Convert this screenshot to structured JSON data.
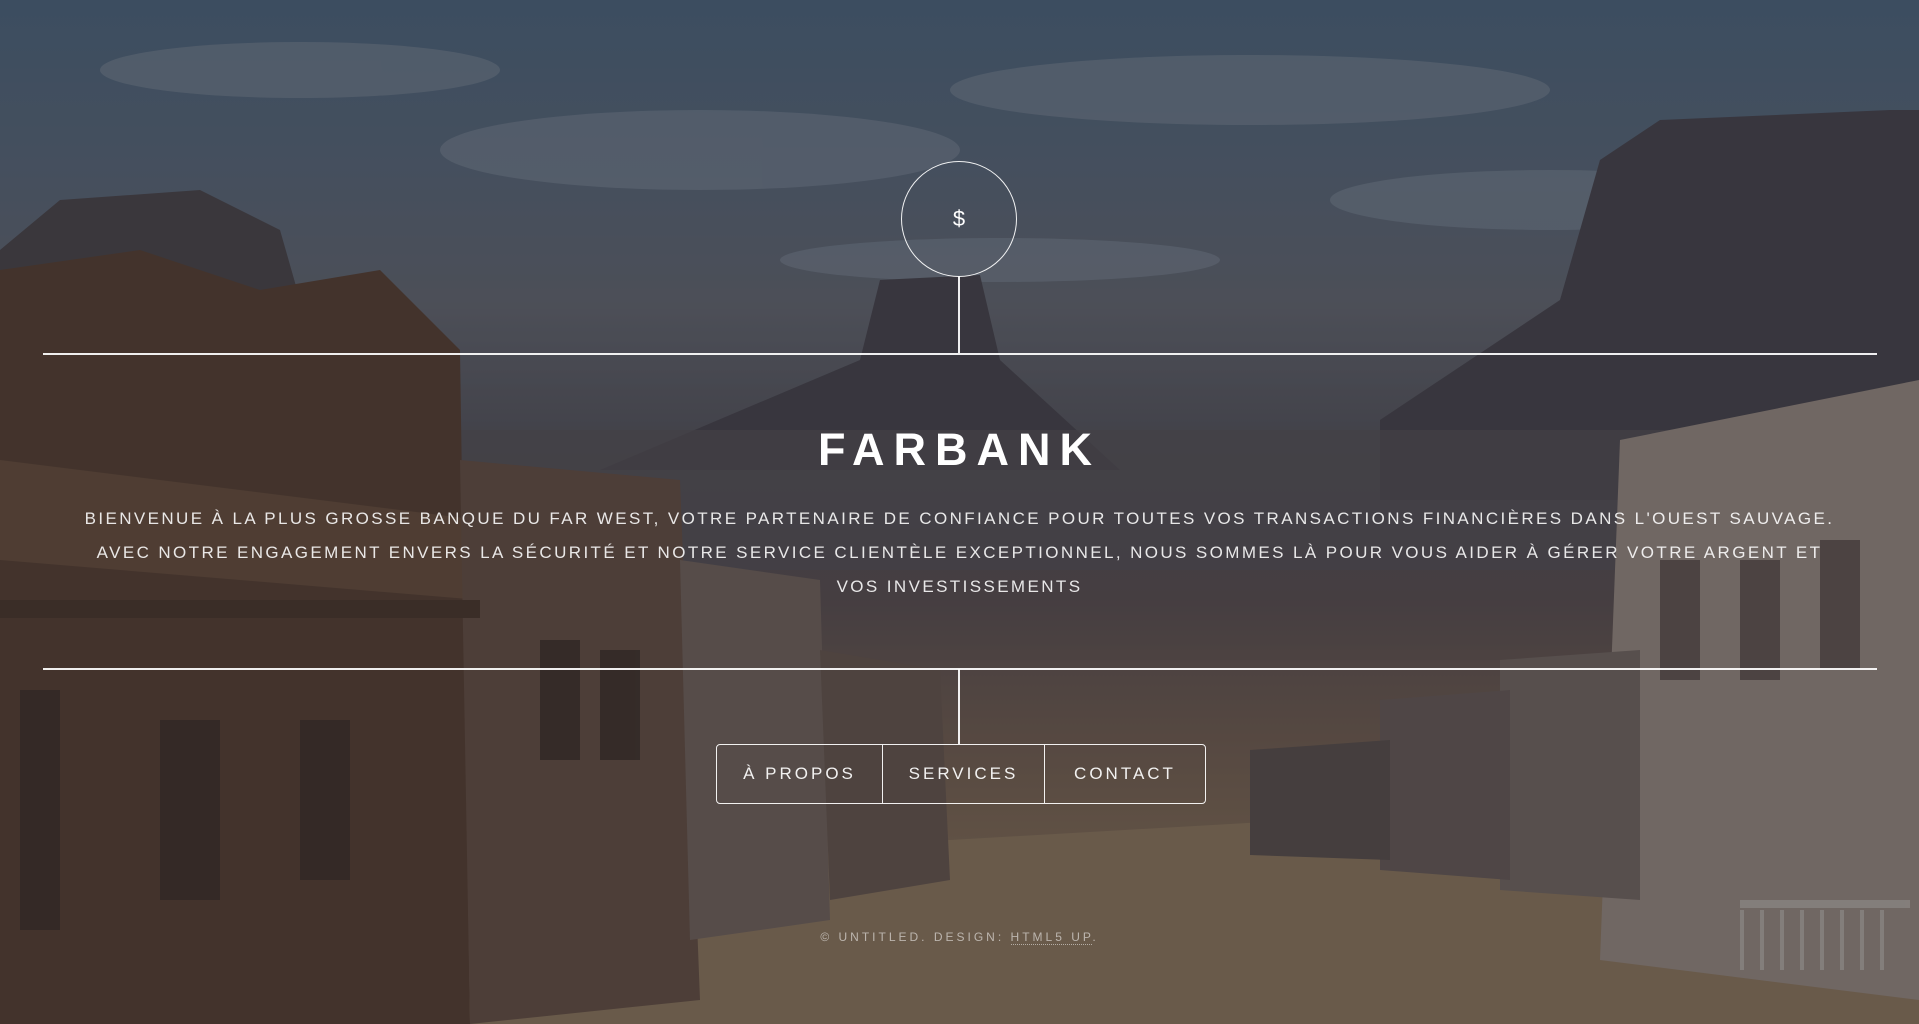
{
  "logo": {
    "symbol": "$"
  },
  "header": {
    "title": "FARBANK",
    "tagline": "Bienvenue à la plus grosse banque du Far West, votre partenaire de confiance pour toutes vos transactions financières dans l'Ouest sauvage. Avec notre engagement envers la sécurité et notre service clientèle exceptionnel, nous sommes là pour vous aider à gérer votre argent et vos investissements"
  },
  "nav": {
    "items": [
      {
        "label": "À propos"
      },
      {
        "label": "Services"
      },
      {
        "label": "Contact"
      }
    ]
  },
  "footer": {
    "copyright": "© Untitled. Design: ",
    "credit_link": "HTML5 UP",
    "suffix": "."
  },
  "colors": {
    "line": "#ffffff",
    "overlay": "rgba(35,35,45,0.42)"
  }
}
